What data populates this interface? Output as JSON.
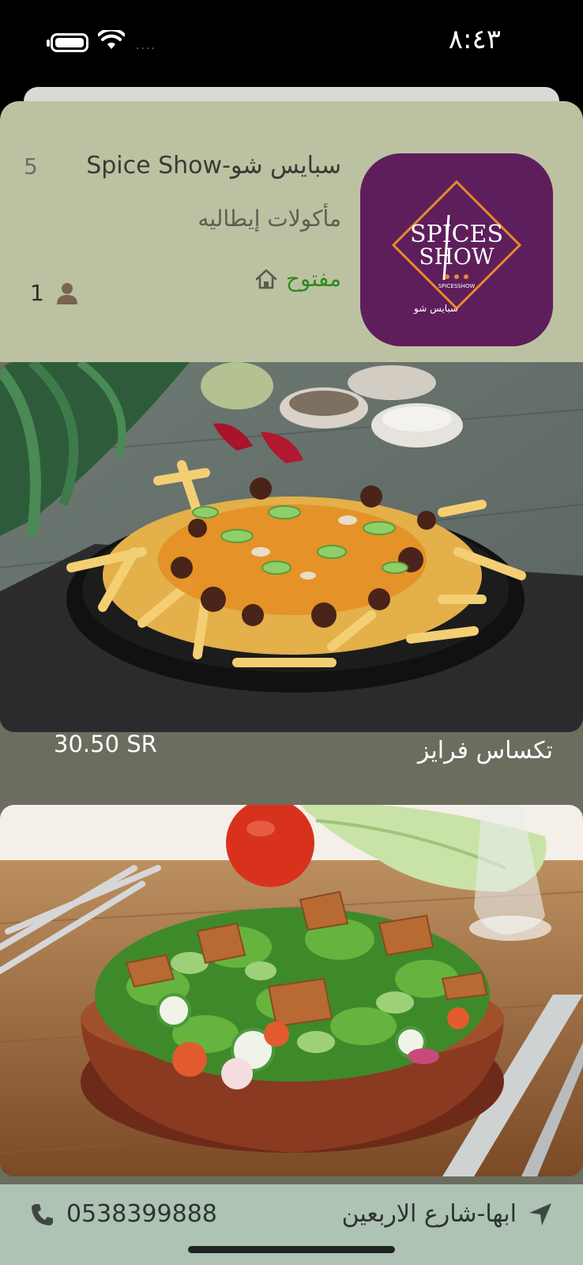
{
  "status_bar": {
    "time": "٨:٤٣",
    "signal_dots": "...."
  },
  "restaurant": {
    "name": "سبايس شو-Spice Show",
    "rating": "5",
    "cuisine": "مأكولات إيطاليه",
    "status": "مفتوح",
    "followers": "1",
    "logo_text_main": "SPICES SHOW",
    "logo_text_sub": "SPICESSHOW",
    "logo_text_ar": "سبايس شو",
    "colors": {
      "logo_bg": "#5e1e5b",
      "logo_accent": "#e68a2e",
      "open": "#2e8a22"
    }
  },
  "menu": {
    "items": [
      {
        "name": "تكساس فرايز",
        "price": "30.50 SR",
        "image": "cheese-fries-photo"
      },
      {
        "name": "",
        "price": "",
        "image": "fattoush-salad-photo"
      }
    ]
  },
  "footer": {
    "phone": "0538399888",
    "address": "ابها-شارع الاربعين",
    "phone_icon": "phone-icon",
    "location_icon": "navigation-arrow-icon"
  }
}
